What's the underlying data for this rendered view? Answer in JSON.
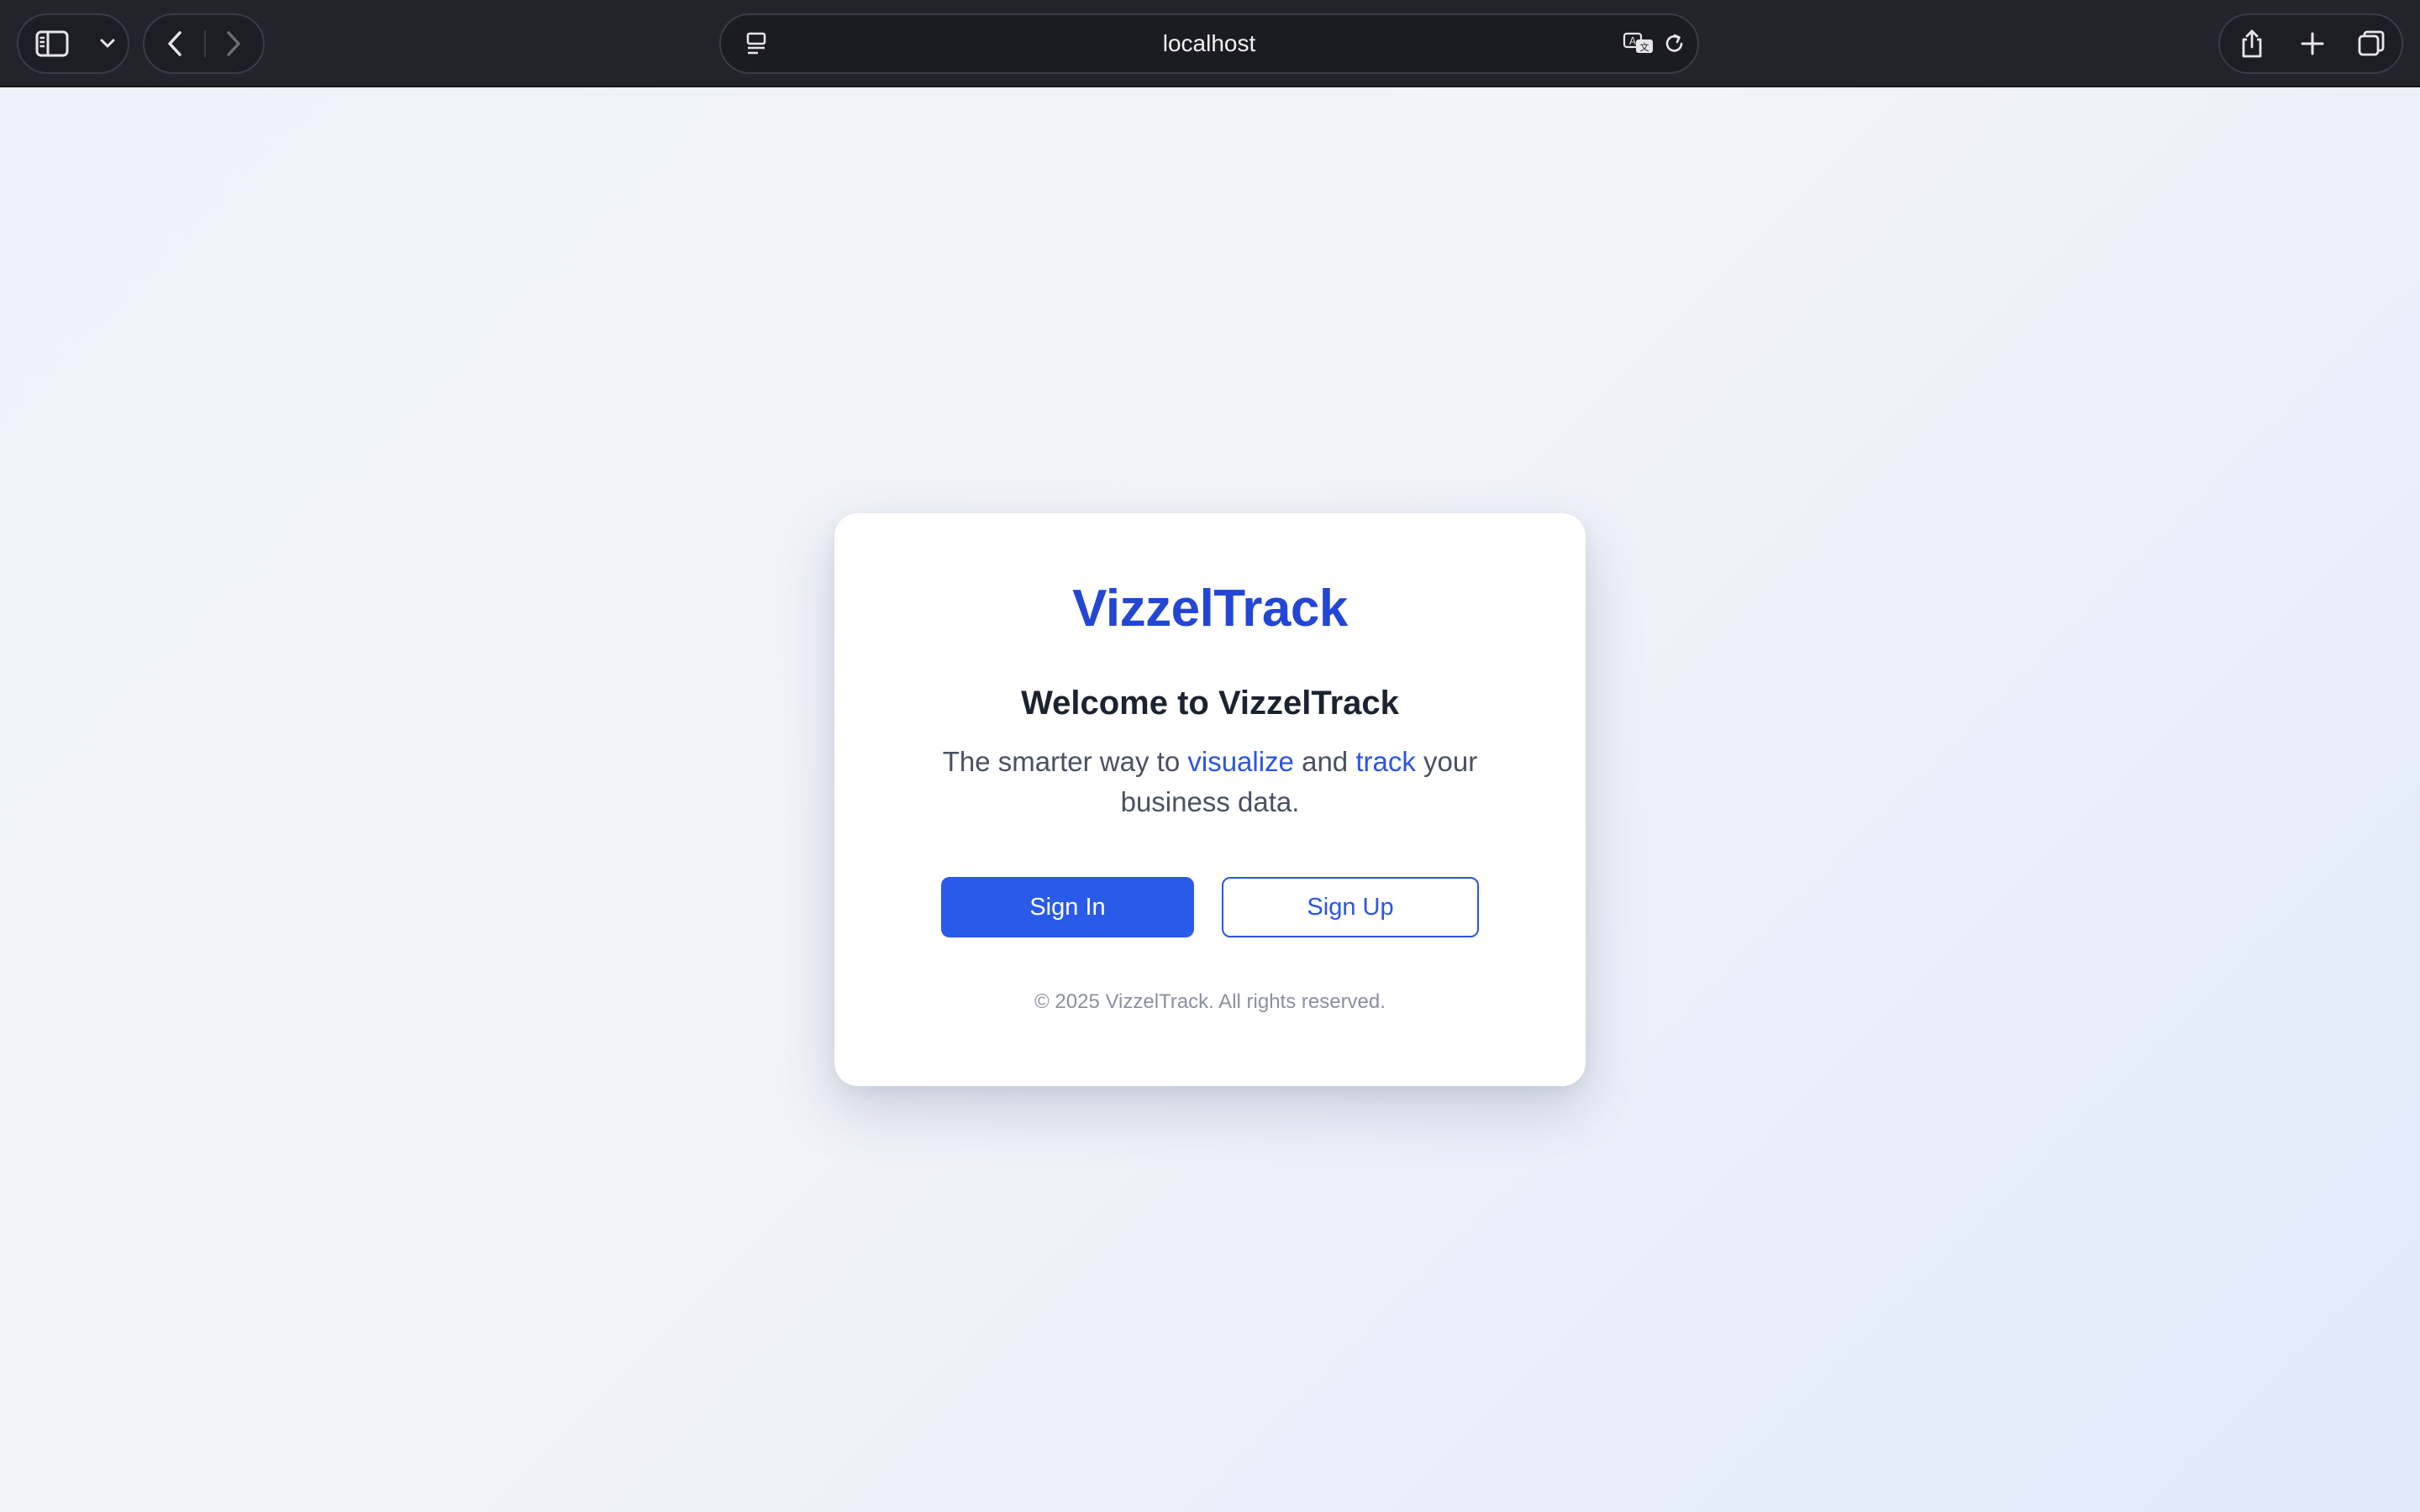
{
  "browser": {
    "address": "localhost",
    "icons": {
      "sidebar": "sidebar-toggle-icon",
      "chevron": "chevron-down-icon",
      "back": "back-arrow-icon",
      "forward": "forward-arrow-icon",
      "reader": "reader-mode-icon",
      "translate": "translate-icon",
      "reload": "reload-icon",
      "share": "share-icon",
      "new_tab": "plus-icon",
      "tabs": "tab-overview-icon"
    }
  },
  "card": {
    "brand": "VizzelTrack",
    "welcome": "Welcome to VizzelTrack",
    "tagline": {
      "part1": "The smarter way to ",
      "highlight1": "visualize",
      "part2": " and ",
      "highlight2": "track",
      "part3": " your business data."
    },
    "sign_in_label": "Sign In",
    "sign_up_label": "Sign Up",
    "copyright": "© 2025 VizzelTrack. All rights reserved."
  },
  "colors": {
    "brand": "#2346d4",
    "primary_button": "#2a5ae8",
    "toolbar": "#22232b"
  }
}
